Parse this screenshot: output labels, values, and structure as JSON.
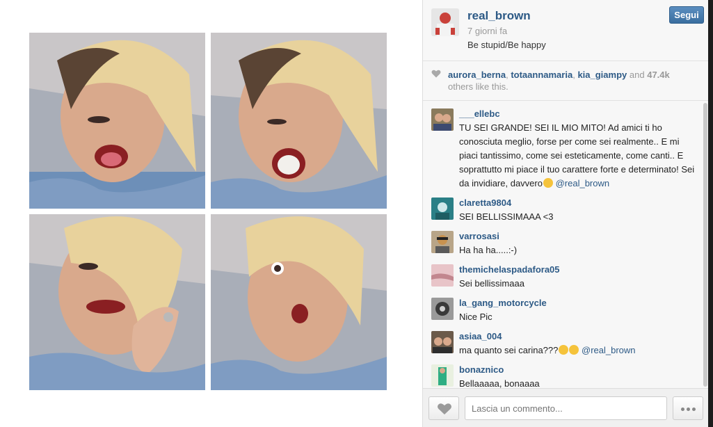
{
  "post": {
    "username": "real_brown",
    "time_ago": "7 giorni fa",
    "caption": "Be stupid/Be happy",
    "follow_label": "Segui"
  },
  "likes": {
    "users": [
      "aurora_berna",
      "totaannamaria",
      "kia_giampy"
    ],
    "and_text": "and",
    "count": "47.4k",
    "suffix": "others like this."
  },
  "comments": [
    {
      "user": "___ellebc",
      "text": "TU SEI GRANDE! SEI IL MIO MITO! Ad amici ti ho conosciuta meglio, forse per come sei realmente.. E mi piaci tantissimo, come sei esteticamente, come canti.. E soprattutto mi piace il tuo carattere forte e determinato! Sei da invidiare, davvero",
      "mention": "@real_brown"
    },
    {
      "user": "claretta9804",
      "text": "SEI BELLISSIMAAA <3"
    },
    {
      "user": "varrosasi",
      "text": "Ha ha ha.....:-)"
    },
    {
      "user": "themichelaspadafora05",
      "text": "Sei bellissimaaa"
    },
    {
      "user": "la_gang_motorcycle",
      "text": "Nice Pic"
    },
    {
      "user": "asiaa_004",
      "text": "ma quanto sei carina???",
      "mention": "@real_brown"
    },
    {
      "user": "bonaznico",
      "text": "Bellaaaaa, bonaaaa"
    }
  ],
  "footer": {
    "comment_placeholder": "Lascia un commento..."
  },
  "colors": {
    "link": "#2d5a86",
    "follow_button": "#3a6e9f",
    "panel_bg": "#f7f7f7"
  },
  "icons": [
    "heart-icon",
    "more-dots-icon"
  ]
}
